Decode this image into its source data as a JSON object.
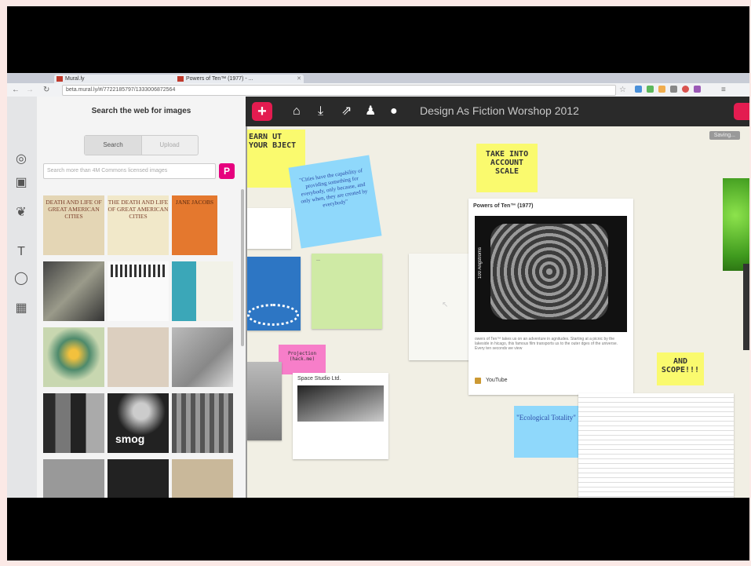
{
  "browser": {
    "tabs": [
      {
        "title": "Mural.ly"
      },
      {
        "title": "Powers of Ten™ (1977) - ..."
      }
    ],
    "url": "beta.mural.ly/#/7722185797/1333006872564"
  },
  "panel": {
    "title": "Search the web for images",
    "tab_search": "Search",
    "tab_upload": "Upload",
    "search_placeholder": "Search more than 4M Commons licensed images",
    "search_button": "P",
    "thumbs": [
      {
        "text": "DEATH AND LIFE OF GREAT AMERICAN CITIES"
      },
      {
        "text": "THE DEATH AND LIFE OF GREAT AMERICAN CITIES"
      },
      {
        "text": "JANE JACOBS"
      },
      {
        "text": ""
      },
      {
        "text": ""
      },
      {
        "text": ""
      },
      {
        "text": ""
      },
      {
        "text": ""
      },
      {
        "text": ""
      },
      {
        "text": ""
      },
      {
        "text": "smog"
      },
      {
        "text": ""
      }
    ]
  },
  "toolbar": {
    "add": "+",
    "board_title": "Design As Fiction Worshop 2012",
    "saving": "Saving..."
  },
  "board": {
    "note_learn": "EARN UT YOUR BJECT",
    "note_cities": "\"Cities have the capability of providing something for everybody, only because, and only when, they are created by everybody\"",
    "note_scale": "TAKE INTO ACCOUNT SCALE",
    "note_scope": "AND SCOPE!!!",
    "note_ecological": "\"Ecological Totality\"",
    "note_projection": "Projection (hack.me)",
    "video_title": "Powers of Ten™ (1977)",
    "video_desc": "owers of Ten™ takes us on an adventure in agnitudes. Starting at a picnic by the lakeside in hicago, this famous film transports us to the outer dges of the universe. Every ten seconds we view",
    "video_source": "YouTube",
    "video_overlay": "100 Angstroms",
    "card_title": "Space Studio Ltd."
  },
  "colors": {
    "brand": "#e31c50",
    "yellow_note": "#fafa6e",
    "blue_note": "#8fd8fb",
    "pink_note": "#f77ec9",
    "green_card": "#cfeaa5"
  }
}
